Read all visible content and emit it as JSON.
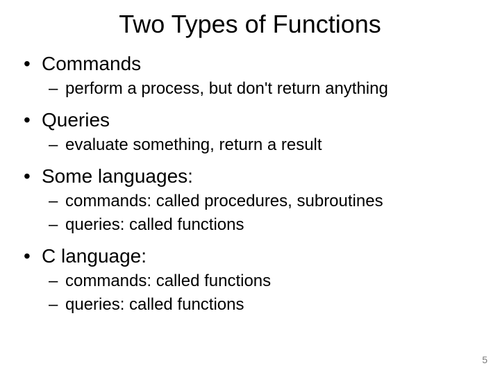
{
  "title": "Two Types of Functions",
  "items": [
    {
      "label": "Commands",
      "subs": [
        "perform a process, but don't return anything"
      ]
    },
    {
      "label": "Queries",
      "subs": [
        "evaluate something, return a result"
      ]
    },
    {
      "label": "Some languages:",
      "subs": [
        "commands: called procedures, subroutines",
        "queries: called functions"
      ]
    },
    {
      "label": "C language:",
      "subs": [
        "commands: called functions",
        "queries: called functions"
      ]
    }
  ],
  "page_number": "5"
}
